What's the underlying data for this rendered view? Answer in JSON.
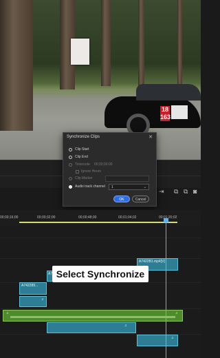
{
  "dialog": {
    "title": "Synchronize Clips",
    "close": "✕",
    "options": [
      {
        "label": "Clip Start",
        "selected": false,
        "enabled": true
      },
      {
        "label": "Clip End",
        "selected": false,
        "enabled": true
      },
      {
        "label": "Timecode",
        "value": "00;00;00;00",
        "selected": false,
        "enabled": false
      },
      {
        "label": "Clip Marker",
        "selected": false,
        "enabled": false
      },
      {
        "label": "Audio track channel",
        "selected": true,
        "enabled": true,
        "value": "1"
      }
    ],
    "ignore_hours": "Ignore Hours",
    "ok": "OK",
    "cancel": "Cancel"
  },
  "timeline": {
    "ticks": [
      "00;00;16;00",
      "00;00;32;00",
      "00;00;48;00",
      "00;01;04;02",
      "00;01;20;02"
    ],
    "clips": {
      "top_right": "A7422B1.mp4[V]",
      "left_small": "A742289...",
      "left_small2": "A7"
    }
  },
  "caption": "Select Synchronize",
  "preview": {
    "plate_number_top": "18",
    "plate_number_bottom": "163"
  }
}
